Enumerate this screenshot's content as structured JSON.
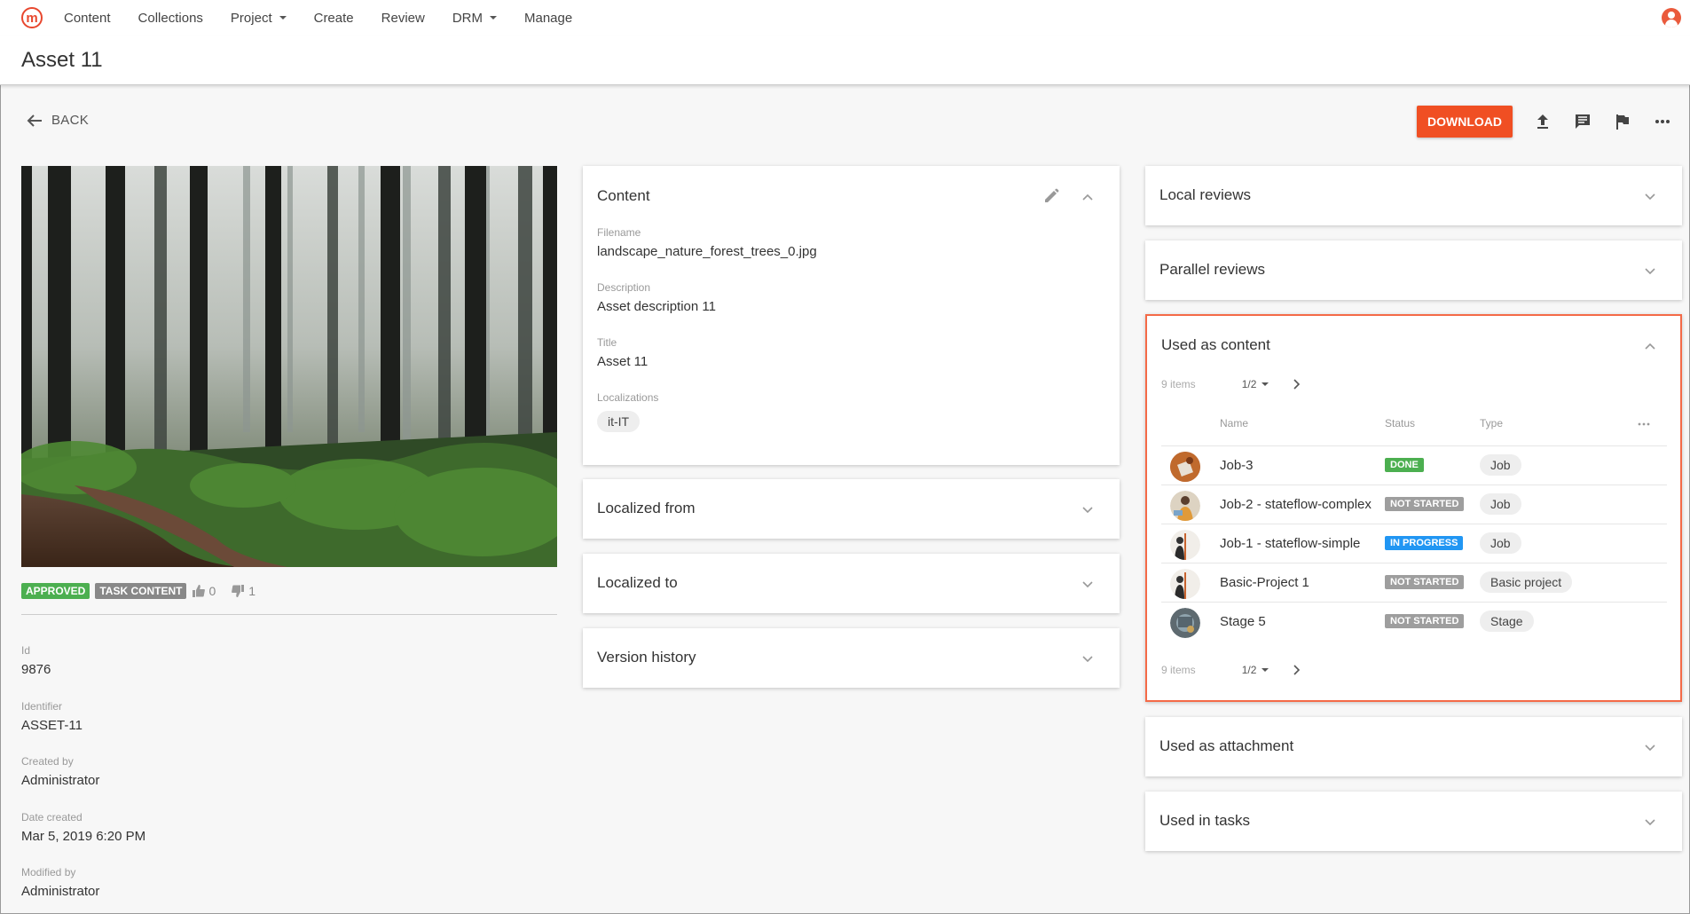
{
  "nav": {
    "logo": "m",
    "items": [
      "Content",
      "Collections",
      "Project",
      "Create",
      "Review",
      "DRM",
      "Manage"
    ]
  },
  "page": {
    "title": "Asset 11"
  },
  "toolbar": {
    "back_label": "BACK",
    "download_label": "DOWNLOAD"
  },
  "asset": {
    "badges": {
      "approved": "APPROVED",
      "task": "TASK CONTENT"
    },
    "votes": {
      "up": "0",
      "down": "1"
    },
    "meta": [
      {
        "label": "Id",
        "value": "9876"
      },
      {
        "label": "Identifier",
        "value": "ASSET-11"
      },
      {
        "label": "Created by",
        "value": "Administrator"
      },
      {
        "label": "Date created",
        "value": "Mar 5, 2019 6:20 PM"
      },
      {
        "label": "Modified by",
        "value": "Administrator"
      }
    ]
  },
  "content_card": {
    "title": "Content",
    "filename_label": "Filename",
    "filename": "landscape_nature_forest_trees_0.jpg",
    "description_label": "Description",
    "description": "Asset description 11",
    "title_label": "Title",
    "title_value": "Asset 11",
    "localizations_label": "Localizations",
    "localization": "it-IT"
  },
  "middle_cards": {
    "localized_from": "Localized from",
    "localized_to": "Localized to",
    "version_history": "Version history"
  },
  "right_cards": {
    "local_reviews": "Local reviews",
    "parallel_reviews": "Parallel reviews",
    "used_as_attachment": "Used as attachment",
    "used_in_tasks": "Used in tasks"
  },
  "used_as_content": {
    "title": "Used as content",
    "count": "9 items",
    "page": "1/2",
    "columns": {
      "name": "Name",
      "status": "Status",
      "type": "Type"
    },
    "rows": [
      {
        "name": "Job-3",
        "status": "DONE",
        "type": "Job"
      },
      {
        "name": "Job-2 - stateflow-complex",
        "status": "NOT STARTED",
        "type": "Job"
      },
      {
        "name": "Job-1 - stateflow-simple",
        "status": "IN PROGRESS",
        "type": "Job"
      },
      {
        "name": "Basic-Project 1",
        "status": "NOT STARTED",
        "type": "Basic project"
      },
      {
        "name": "Stage 5",
        "status": "NOT STARTED",
        "type": "Stage"
      }
    ]
  },
  "colors": {
    "accent": "#f04f23",
    "done": "#4caf50",
    "in_progress": "#2196f3",
    "not_started": "#9e9e9e"
  }
}
